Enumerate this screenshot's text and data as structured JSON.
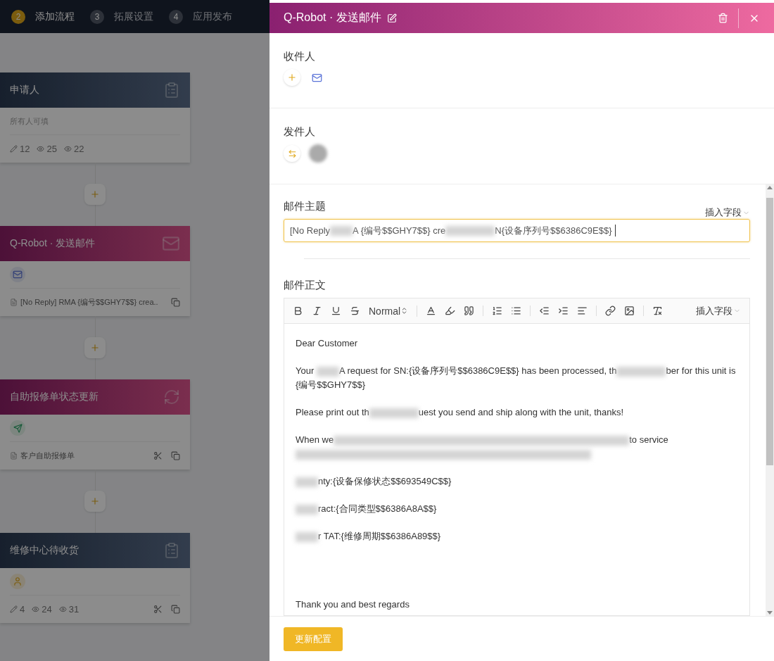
{
  "steps": [
    {
      "number": "2",
      "label": "添加流程",
      "selected": true
    },
    {
      "number": "3",
      "label": "拓展设置",
      "selected": false
    },
    {
      "number": "4",
      "label": "应用发布",
      "selected": false
    }
  ],
  "flow": [
    {
      "kind": "form",
      "title": "申请人",
      "subtitle": "所有人可填",
      "stats": [
        "12",
        "25",
        "22"
      ]
    },
    {
      "kind": "email",
      "title": "Q-Robot · 发送邮件",
      "summary": "[No Reply] RMA {编号$$GHY7$$} crea.."
    },
    {
      "kind": "update",
      "title": "自助报修单状态更新",
      "summary": "客户自助报修单"
    },
    {
      "kind": "task",
      "title": "维修中心待收货",
      "stats": [
        "4",
        "24",
        "31"
      ]
    }
  ],
  "drawer": {
    "title": "Q-Robot · 发送邮件",
    "recipients": {
      "label": "收件人"
    },
    "sender": {
      "label": "发件人"
    },
    "subject": {
      "label": "邮件主题",
      "insert_field": "插入字段",
      "segments": [
        {
          "kind": "text",
          "text": "[No Reply"
        },
        {
          "kind": "blur"
        },
        {
          "kind": "text",
          "text": "A {编号$$GHY7$$} cre"
        },
        {
          "kind": "wide_blur"
        },
        {
          "kind": "text",
          "text": "N{设备序列号$$6386C9E$$}"
        }
      ]
    },
    "body": {
      "label": "邮件正文",
      "format": "Normal",
      "insert_field": "插入字段",
      "paragraphs": [
        {
          "kind": "line",
          "segments": [
            {
              "kind": "text",
              "text": "Dear Customer"
            }
          ]
        },
        {
          "kind": "line",
          "segments": [
            {
              "kind": "text",
              "text": "Your "
            },
            {
              "kind": "blur"
            },
            {
              "kind": "text",
              "text": "A request for SN:{设备序列号$$6386C9E$$} has been processed, th"
            },
            {
              "kind": "wide_blur"
            },
            {
              "kind": "text",
              "text": "ber for this unit is {编号$$GHY7$$}"
            }
          ]
        },
        {
          "kind": "line",
          "segments": [
            {
              "kind": "text",
              "text": "Please print out th"
            },
            {
              "kind": "wide_blur"
            },
            {
              "kind": "text",
              "text": "uest you send and ship along with the unit, thanks!"
            }
          ]
        },
        {
          "kind": "line",
          "segments": [
            {
              "kind": "text",
              "text": "When we"
            },
            {
              "kind": "line_blur"
            },
            {
              "kind": "text",
              "text": "to service"
            },
            {
              "kind": "line_blur"
            }
          ]
        },
        {
          "kind": "line",
          "segments": [
            {
              "kind": "blur"
            },
            {
              "kind": "text",
              "text": "nty:{设备保修状态$$693549C$$}"
            }
          ]
        },
        {
          "kind": "line",
          "segments": [
            {
              "kind": "blur"
            },
            {
              "kind": "text",
              "text": "ract:{合同类型$$6386A8A$$}"
            }
          ]
        },
        {
          "kind": "line",
          "segments": [
            {
              "kind": "blur"
            },
            {
              "kind": "text",
              "text": "r TAT:{维修周期$$6386A89$$}"
            }
          ]
        },
        {
          "kind": "closing",
          "segments": [
            {
              "kind": "text",
              "text": "Thank you and best regards"
            }
          ]
        }
      ]
    },
    "submit": "更新配置"
  }
}
